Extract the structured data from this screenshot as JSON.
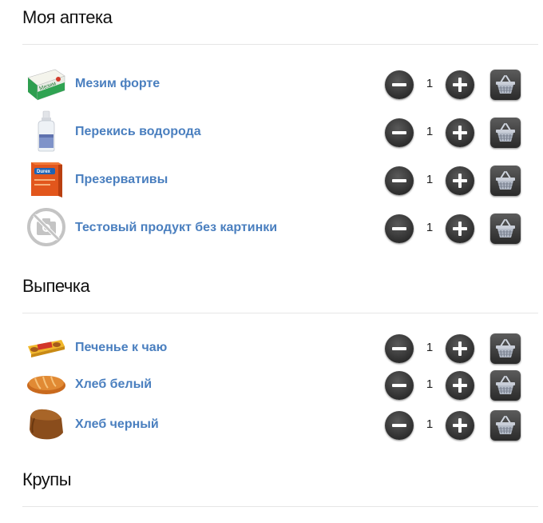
{
  "sections": [
    {
      "title": "Моя аптека",
      "items": [
        {
          "name": "Мезим форте",
          "qty": "1",
          "image": "mezim-box-icon"
        },
        {
          "name": "Перекись водорода",
          "qty": "1",
          "image": "bottle-icon"
        },
        {
          "name": "Презервативы",
          "qty": "1",
          "image": "condom-box-icon"
        },
        {
          "name": "Тестовый продукт без картинки",
          "qty": "1",
          "image": "no-photo-icon"
        }
      ]
    },
    {
      "title": "Выпечка",
      "items": [
        {
          "name": "Печенье к чаю",
          "qty": "1",
          "image": "cookie-pack-icon"
        },
        {
          "name": "Хлеб белый",
          "qty": "1",
          "image": "white-bread-icon"
        },
        {
          "name": "Хлеб черный",
          "qty": "1",
          "image": "black-bread-icon"
        }
      ]
    },
    {
      "title": "Крупы",
      "items": []
    }
  ],
  "controls": {
    "minus_icon": "minus-icon",
    "plus_icon": "plus-icon",
    "cart_icon": "basket-icon"
  },
  "colors": {
    "link": "#4a7fbf",
    "button_dark": "#2e2e2e",
    "divider": "#e6e6e6"
  }
}
